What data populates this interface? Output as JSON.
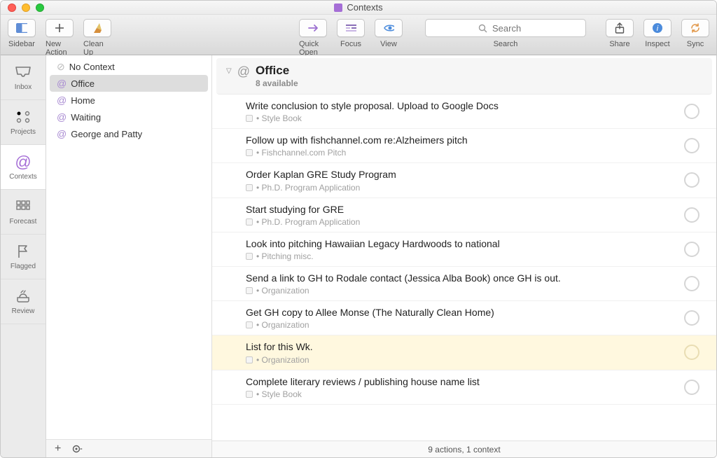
{
  "window": {
    "title": "Contexts"
  },
  "toolbar": {
    "sidebar": "Sidebar",
    "newAction": "New Action",
    "cleanUp": "Clean Up",
    "quickOpen": "Quick Open",
    "focus": "Focus",
    "view": "View",
    "searchLabel": "Search",
    "searchPlaceholder": "Search",
    "share": "Share",
    "inspect": "Inspect",
    "sync": "Sync"
  },
  "nav": {
    "inbox": "Inbox",
    "projects": "Projects",
    "contexts": "Contexts",
    "forecast": "Forecast",
    "flagged": "Flagged",
    "review": "Review"
  },
  "contexts": {
    "items": [
      {
        "label": "No Context",
        "none": true
      },
      {
        "label": "Office",
        "selected": true
      },
      {
        "label": "Home"
      },
      {
        "label": "Waiting"
      },
      {
        "label": "George and Patty"
      }
    ]
  },
  "header": {
    "title": "Office",
    "subtitle": "8 available"
  },
  "tasks": [
    {
      "title": "Write conclusion to style proposal. Upload to Google Docs",
      "project": "Style Book"
    },
    {
      "title": "Follow up with fishchannel.com re:Alzheimers pitch",
      "project": "Fishchannel.com Pitch"
    },
    {
      "title": "Order Kaplan GRE Study Program",
      "project": "Ph.D. Program Application"
    },
    {
      "title": "Start studying for GRE",
      "project": "Ph.D. Program Application"
    },
    {
      "title": "Look into pitching Hawaiian Legacy Hardwoods to national",
      "project": "Pitching misc."
    },
    {
      "title": "Send a link to GH to Rodale contact (Jessica Alba Book) once GH is out.",
      "project": "Organization"
    },
    {
      "title": "Get GH copy to Allee Monse (The Naturally Clean Home)",
      "project": "Organization"
    },
    {
      "title": "List for this Wk.",
      "project": "Organization",
      "highlight": true
    },
    {
      "title": "Complete literary reviews / publishing house name list",
      "project": "Style Book"
    }
  ],
  "status": "9 actions, 1 context"
}
